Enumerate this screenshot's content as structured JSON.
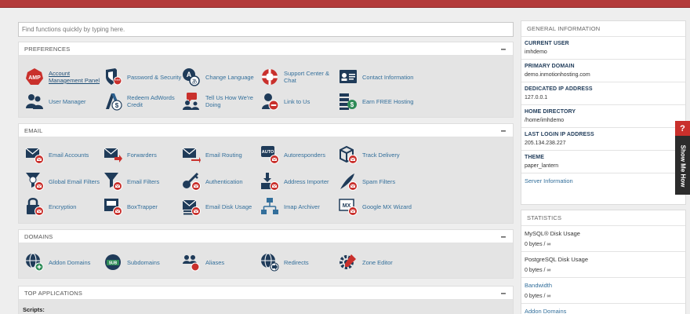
{
  "search": {
    "placeholder": "Find functions quickly by typing here."
  },
  "preferences": {
    "title": "PREFERENCES",
    "collapse": "–",
    "items": [
      {
        "label": "Account Management Panel",
        "icon": "amp-icon"
      },
      {
        "label": "Password & Security",
        "icon": "shield-icon"
      },
      {
        "label": "Change Language",
        "icon": "language-icon"
      },
      {
        "label": "Support Center & Chat",
        "icon": "lifebuoy-icon"
      },
      {
        "label": "Contact Information",
        "icon": "contact-card-icon"
      },
      {
        "label": "User Manager",
        "icon": "users-icon"
      },
      {
        "label": "Redeem AdWords Credit",
        "icon": "adwords-icon"
      },
      {
        "label": "Tell Us How We're Doing",
        "icon": "feedback-icon"
      },
      {
        "label": "Link to Us",
        "icon": "link-icon"
      },
      {
        "label": "Earn FREE Hosting",
        "icon": "money-icon"
      }
    ]
  },
  "email": {
    "title": "EMAIL",
    "collapse": "–",
    "items": [
      {
        "label": "Email Accounts",
        "icon": "email-accounts-icon"
      },
      {
        "label": "Forwarders",
        "icon": "forwarders-icon"
      },
      {
        "label": "Email Routing",
        "icon": "email-routing-icon"
      },
      {
        "label": "Autoresponders",
        "icon": "autoresponders-icon"
      },
      {
        "label": "Track Delivery",
        "icon": "track-delivery-icon"
      },
      {
        "label": "Global Email Filters",
        "icon": "global-filter-icon"
      },
      {
        "label": "Email Filters",
        "icon": "email-filter-icon"
      },
      {
        "label": "Authentication",
        "icon": "key-icon"
      },
      {
        "label": "Address Importer",
        "icon": "importer-icon"
      },
      {
        "label": "Spam Filters",
        "icon": "spam-icon"
      },
      {
        "label": "Encryption",
        "icon": "lock-icon"
      },
      {
        "label": "BoxTrapper",
        "icon": "boxtrapper-icon"
      },
      {
        "label": "Email Disk Usage",
        "icon": "disk-usage-icon"
      },
      {
        "label": "Imap Archiver",
        "icon": "archiver-icon"
      },
      {
        "label": "Google MX Wizard",
        "icon": "mx-wizard-icon"
      }
    ]
  },
  "domains": {
    "title": "DOMAINS",
    "collapse": "–",
    "items": [
      {
        "label": "Addon Domains",
        "icon": "addon-domain-icon"
      },
      {
        "label": "Subdomains",
        "icon": "subdomain-icon"
      },
      {
        "label": "Aliases",
        "icon": "aliases-icon"
      },
      {
        "label": "Redirects",
        "icon": "redirect-icon"
      },
      {
        "label": "Zone Editor",
        "icon": "zone-editor-icon"
      }
    ]
  },
  "top_apps": {
    "title": "TOP APPLICATIONS",
    "collapse": "–",
    "scripts_label": "Scripts:"
  },
  "general_info": {
    "title": "GENERAL INFORMATION",
    "rows": [
      {
        "label": "CURRENT USER",
        "value": "imhdemo"
      },
      {
        "label": "PRIMARY DOMAIN",
        "value": "demo.inmotionhosting.com"
      },
      {
        "label": "DEDICATED IP ADDRESS",
        "value": "127.0.0.1"
      },
      {
        "label": "HOME DIRECTORY",
        "value": "/home/imhdemo"
      },
      {
        "label": "LAST LOGIN IP ADDRESS",
        "value": "205.134.238.227"
      },
      {
        "label": "THEME",
        "value": "paper_lantern"
      }
    ],
    "server_info_link": "Server Information"
  },
  "statistics": {
    "title": "STATISTICS",
    "rows": [
      {
        "label": "MySQL® Disk Usage",
        "value": "0 bytes / ∞"
      },
      {
        "label": "PostgreSQL Disk Usage",
        "value": "0 bytes / ∞"
      },
      {
        "label": "Bandwidth",
        "value": "0 bytes / ∞"
      },
      {
        "label": "Addon Domains",
        "value": ""
      }
    ]
  },
  "help_tab": {
    "icon_text": "?",
    "label": "Show Me How"
  },
  "colors": {
    "topbar": "#b33a3a",
    "icon_navy": "#1f3b59",
    "badge_red": "#c9302c",
    "link_blue": "#336f9b"
  }
}
